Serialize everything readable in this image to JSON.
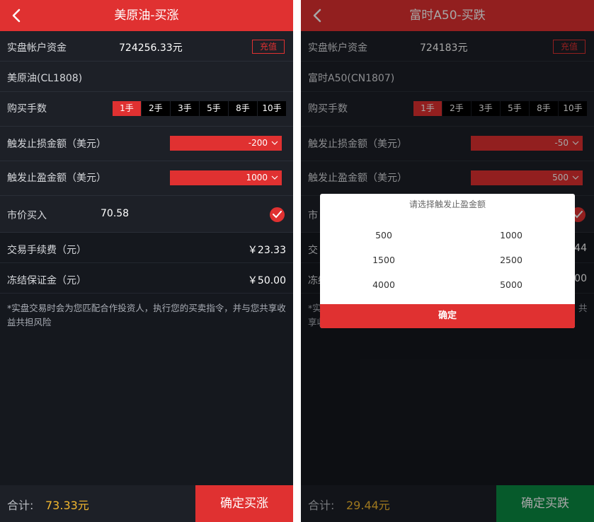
{
  "left": {
    "header": {
      "title": "美原油-买涨"
    },
    "account": {
      "label": "实盘帐户资金",
      "value": "724256.33元",
      "recharge": "充值"
    },
    "product": {
      "name": "美原油(CL1808)"
    },
    "lots": {
      "label": "购买手数",
      "options": [
        "1手",
        "2手",
        "3手",
        "5手",
        "8手",
        "10手"
      ],
      "selected": "1手"
    },
    "stop_loss": {
      "label": "触发止损金额（美元）",
      "value": "-200"
    },
    "take_profit": {
      "label": "触发止盈金额（美元）",
      "value": "1000"
    },
    "market": {
      "label": "市价买入",
      "value": "70.58"
    },
    "fee": {
      "label": "交易手续费（元）",
      "value": "￥23.33"
    },
    "margin": {
      "label": "冻结保证金（元）",
      "value": "￥50.00"
    },
    "notice": "*实盘交易时会为您匹配合作投资人，执行您的买卖指令，并与您共享收益共担风险",
    "footer": {
      "total_label": "合计:",
      "total_value": "73.33元",
      "confirm": "确定买涨"
    }
  },
  "right": {
    "header": {
      "title": "富时A50-买跌"
    },
    "account": {
      "label": "实盘帐户资金",
      "value": "724183元",
      "recharge": "充值"
    },
    "product": {
      "name": "富时A50(CN1807)"
    },
    "lots": {
      "label": "购买手数",
      "options": [
        "1手",
        "2手",
        "3手",
        "5手",
        "8手",
        "10手"
      ],
      "selected": "1手"
    },
    "stop_loss": {
      "label": "触发止损金额（美元）",
      "value": "-50"
    },
    "take_profit": {
      "label": "触发止盈金额（美元）",
      "value": "500"
    },
    "market_label_partial": "市",
    "fee_partial": {
      "label": "交",
      "value": "44"
    },
    "margin_partial": {
      "label": "冻结",
      "value": "00"
    },
    "notice_partial": [
      "*实",
      "享收",
      "共"
    ],
    "footer": {
      "total_label": "合计:",
      "total_value": "29.44元",
      "confirm": "确定买跌"
    },
    "dialog": {
      "title": "请选择触发止盈金额",
      "options": [
        "500",
        "1000",
        "1500",
        "2500",
        "4000",
        "5000"
      ],
      "confirm": "确定"
    }
  },
  "colors": {
    "accent_red": "#e03131",
    "confirm_green": "#0a8a43",
    "total_gold": "#f3b82f",
    "bg_dark": "#15181e",
    "row_bg": "#1d2027"
  }
}
